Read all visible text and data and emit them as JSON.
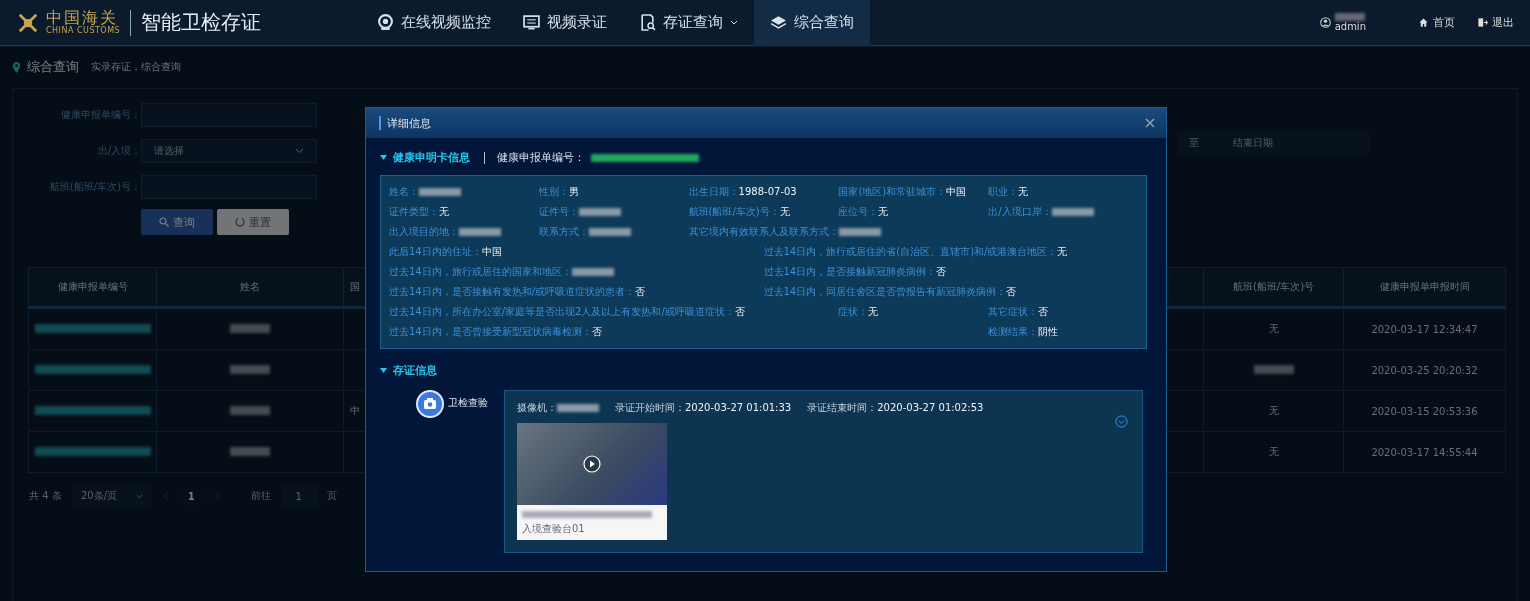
{
  "header": {
    "logo_cn": "中国海关",
    "logo_en": "CHINA CUSTOMS",
    "app_title": "智能卫检存证",
    "nav": [
      {
        "label": "在线视频监控",
        "dropdown": false,
        "selected": false
      },
      {
        "label": "视频录证",
        "dropdown": false,
        "selected": false
      },
      {
        "label": "存证查询",
        "dropdown": true,
        "selected": false
      },
      {
        "label": "综合查询",
        "dropdown": false,
        "selected": true
      }
    ],
    "user": {
      "role": "admin"
    },
    "links": [
      {
        "label": "首页"
      },
      {
        "label": "退出"
      }
    ]
  },
  "breadcrumb": {
    "title": "综合查询",
    "path": "实录存证，综合查询"
  },
  "filters": [
    {
      "label": "健康申报单编号：",
      "kind": "input"
    },
    {
      "label": "出/入境：",
      "kind": "select",
      "placeholder": "请选择"
    },
    {
      "label": "航班(船班/车次)号：",
      "kind": "input"
    }
  ],
  "date_range": {
    "separator": "至",
    "end_placeholder": "结束日期"
  },
  "buttons": [
    {
      "label": "查询",
      "kind": "primary"
    },
    {
      "label": "重置",
      "kind": "secondary"
    }
  ],
  "table": {
    "columns": [
      "健康申报单编号",
      "姓名",
      "国",
      "航班(船班/车次)号",
      "健康申报单申报时间"
    ],
    "rows": [
      [
        {
          "kind": "link"
        },
        {
          "kind": "masked"
        },
        {
          "kind": "empty"
        },
        {
          "kind": "text",
          "text": "无"
        },
        {
          "kind": "text",
          "text": "2020-03-17 12:34:47"
        }
      ],
      [
        {
          "kind": "link"
        },
        {
          "kind": "masked"
        },
        {
          "kind": "empty"
        },
        {
          "kind": "masked"
        },
        {
          "kind": "text",
          "text": "2020-03-25 20:20:32"
        }
      ],
      [
        {
          "kind": "link"
        },
        {
          "kind": "masked"
        },
        {
          "kind": "text",
          "text": "中"
        },
        {
          "kind": "text",
          "text": "无"
        },
        {
          "kind": "text",
          "text": "2020-03-15 20:53:36"
        }
      ],
      [
        {
          "kind": "link"
        },
        {
          "kind": "masked"
        },
        {
          "kind": "empty"
        },
        {
          "kind": "text",
          "text": "无"
        },
        {
          "kind": "text",
          "text": "2020-03-17 14:55:44"
        }
      ]
    ]
  },
  "pagination": {
    "total": "共 4 条",
    "page_size": "20条/页",
    "pages": [
      {
        "label": "1",
        "selected": true
      }
    ],
    "goto_label": "前往",
    "goto_value": "1",
    "goto_suffix": "页"
  },
  "modal": {
    "title": "详细信息",
    "health_card": {
      "heading": "健康申明卡信息",
      "id_label": "健康申报单编号：",
      "rows": [
        {
          "kind": "grid",
          "items": [
            {
              "label": "姓名："
            },
            {
              "label": "性别：",
              "value": "男"
            },
            {
              "label": "出生日期：",
              "value": "1988-07-03"
            },
            {
              "label": "国家(地区)和常驻城市：",
              "value": "中国"
            },
            {
              "label": "职业：",
              "value": "无"
            }
          ]
        },
        {
          "kind": "grid",
          "items": [
            {
              "label": "证件类型：",
              "value": "无"
            },
            {
              "label": "证件号："
            },
            {
              "label": "航班(船班/车次)号：",
              "value": "无"
            },
            {
              "label": "座位号：",
              "value": "无"
            },
            {
              "label": "出/入境口岸："
            }
          ]
        },
        {
          "kind": "grid",
          "items": [
            {
              "label": "出入境目的地："
            },
            {
              "label": "联系方式："
            },
            {
              "label": "其它境内有效联系人及联系方式："
            }
          ]
        },
        {
          "kind": "half",
          "items": [
            {
              "label": "此后14日内的住址：",
              "value": "中国"
            },
            {
              "label": "过去14日内，旅行或居住的省(自治区、直辖市)和/或港澳台地区：",
              "value": "无"
            }
          ]
        },
        {
          "kind": "half",
          "items": [
            {
              "label": "过去14日内，旅行或居住的国家和地区："
            },
            {
              "label": "过去14日内，是否接触新冠肺炎病例：",
              "value": "否"
            }
          ]
        },
        {
          "kind": "half",
          "items": [
            {
              "label": "过去14日内，是否接触有发热和/或呼吸道症状的患者：",
              "value": "否"
            },
            {
              "label": "过去14日内，同居住舍区是否曾报告有新冠肺炎病例：",
              "value": "否"
            }
          ]
        },
        {
          "kind": "tail",
          "items": [
            {
              "label": "过去14日内，所在办公室/家庭等是否出现2人及以上有发热和/或呼吸道症状：",
              "value": "否"
            },
            {
              "label": "症状：",
              "value": "无"
            },
            {
              "label": "其它症状：",
              "value": "否"
            }
          ]
        },
        {
          "kind": "tail",
          "items": [
            {
              "label": "过去14日内，是否曾接受新型冠状病毒检测：",
              "value": "否"
            },
            {
              "label": "检测结果：",
              "value": "阴性"
            }
          ]
        }
      ]
    },
    "evidence": {
      "heading": "存证信息",
      "category": "卫检查验",
      "meta": [
        {
          "label": "摄像机："
        },
        {
          "label": "录证开始时间：",
          "value": "2020-03-27 01:01:33"
        },
        {
          "label": "录证结束时间：",
          "value": "2020-03-27 01:02:53"
        }
      ],
      "video": {
        "caption": "入境查验台01"
      }
    }
  }
}
